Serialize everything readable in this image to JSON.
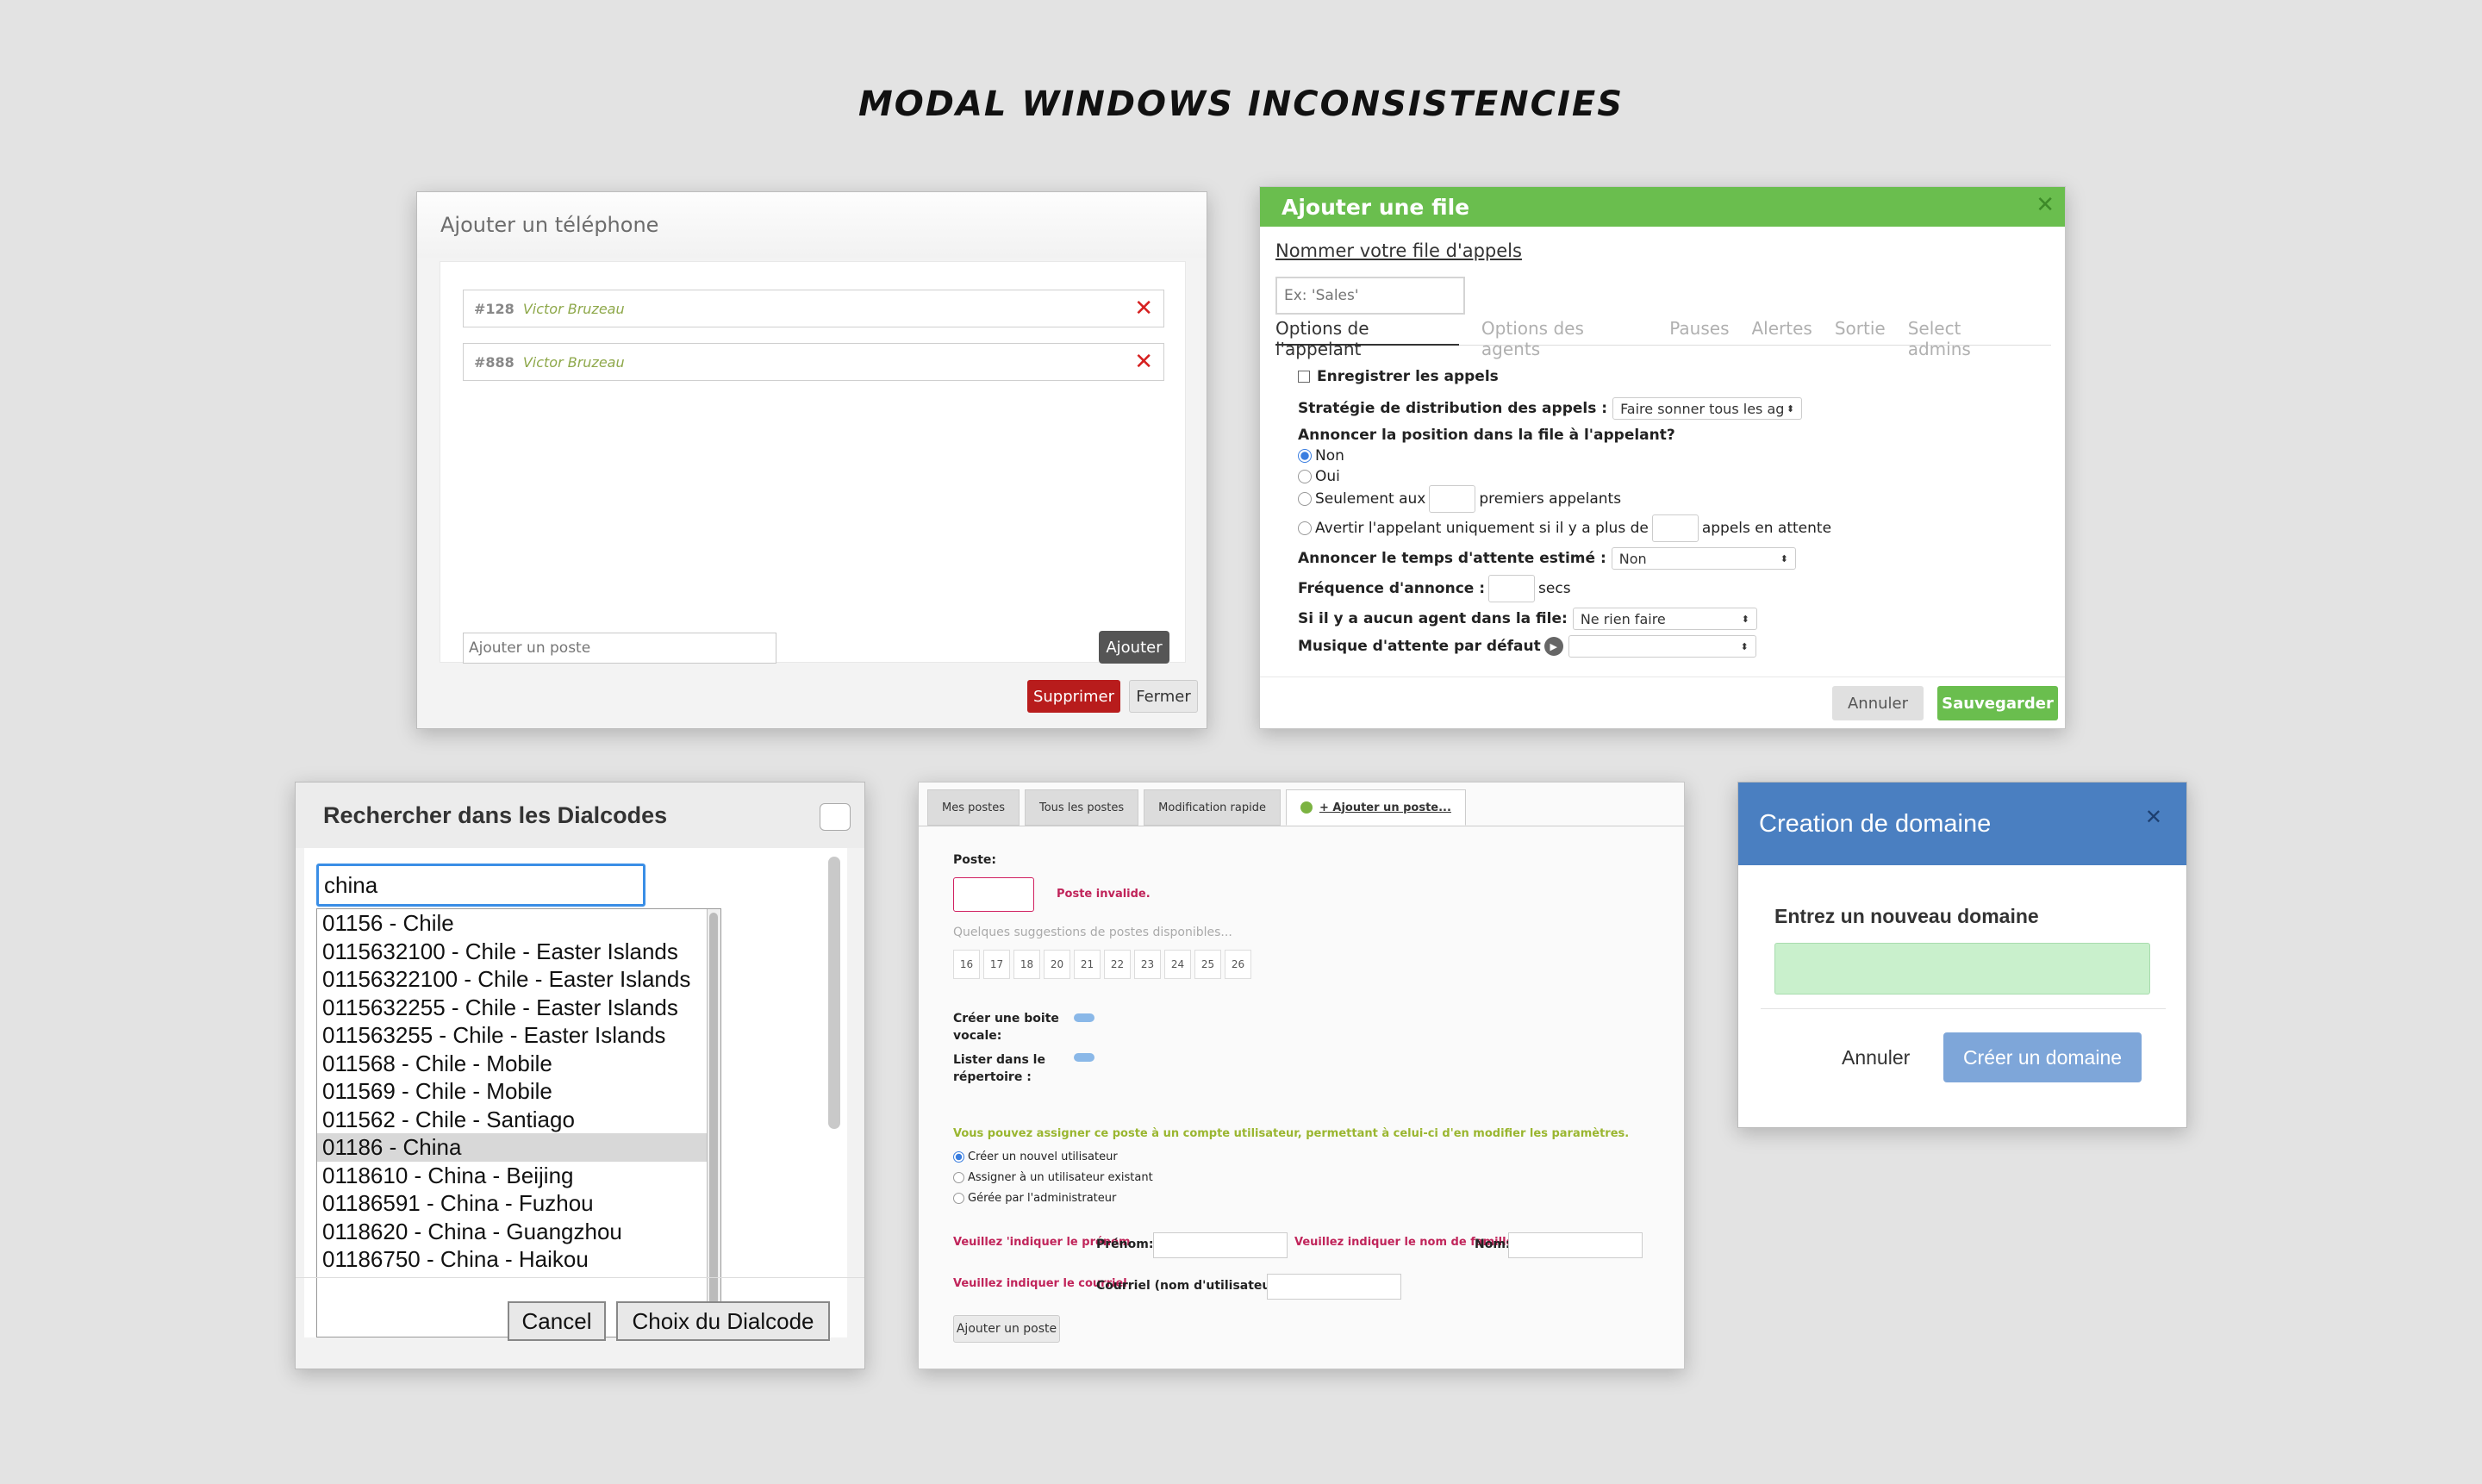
{
  "title": "MODAL WINDOWS INCONSISTENCIES",
  "modal_phone": {
    "title": "Ajouter un téléphone",
    "rows": [
      {
        "number": "#128",
        "name": "Victor Bruzeau"
      },
      {
        "number": "#888",
        "name": "Victor Bruzeau"
      }
    ],
    "poste_placeholder": "Ajouter un poste",
    "add_label": "Ajouter",
    "delete_label": "Supprimer",
    "close_label": "Fermer"
  },
  "modal_queue": {
    "title": "Ajouter une file",
    "subtitle": "Nommer votre file d'appels",
    "name_placeholder": "Ex: 'Sales'",
    "tabs": [
      "Options de l'appelant",
      "Options des agents",
      "Pauses",
      "Alertes",
      "Sortie",
      "Select admins"
    ],
    "record_label": "Enregistrer les appels",
    "strategy_label": "Stratégie de distribution des appels :",
    "strategy_value": "Faire sonner tous les agents",
    "announce_position_label": "Annoncer la position dans la file à l'appelant?",
    "opt_non": "Non",
    "opt_oui": "Oui",
    "opt_only_pre": "Seulement aux",
    "opt_only_post": "premiers appelants",
    "opt_warn_pre": "Avertir l'appelant uniquement si il y a plus de",
    "opt_warn_post": "appels en attente",
    "wait_label": "Annoncer le temps d'attente estimé :",
    "wait_value": "Non",
    "freq_label": "Fréquence d'annonce :",
    "freq_unit": "secs",
    "no_agent_label": "Si il y a aucun agent dans la file:",
    "no_agent_value": "Ne rien faire",
    "music_label": "Musique d'attente par défaut",
    "cancel_label": "Annuler",
    "save_label": "Sauvegarder"
  },
  "modal_dialcodes": {
    "title": "Rechercher dans les Dialcodes",
    "search_value": "china",
    "items": [
      "01156 - Chile",
      "0115632100 - Chile - Easter Islands",
      "01156322100 - Chile - Easter Islands",
      "0115632255 - Chile - Easter Islands",
      "011563255 - Chile - Easter Islands",
      "011568 - Chile - Mobile",
      "011569 - Chile - Mobile",
      "011562 - Chile - Santiago",
      "01186 - China",
      "0118610 - China - Beijing",
      "01186591 - China - Fuzhou",
      "0118620 - China - Guangzhou",
      "01186750 - China - Haikou"
    ],
    "selected_index": 8,
    "cancel_label": "Cancel",
    "choose_label": "Choix du Dialcode"
  },
  "modal_postes": {
    "tabs": [
      "Mes postes",
      "Tous les postes",
      "Modification rapide",
      "+ Ajouter un poste..."
    ],
    "poste_label": "Poste:",
    "poste_error": "Poste invalide.",
    "suggest_text": "Quelques suggestions de postes disponibles...",
    "suggestions": [
      "16",
      "17",
      "18",
      "20",
      "21",
      "22",
      "23",
      "24",
      "25",
      "26"
    ],
    "voicemail_label": "Créer une boite vocale:",
    "directory_label": "Lister dans le répertoire :",
    "assign_text": "Vous pouvez assigner ce poste à un compte utilisateur, permettant à celui-ci d'en modifier les paramètres.",
    "assign_options": [
      "Créer un nouvel utilisateur",
      "Assigner à un utilisateur existant",
      "Gérée par l'administrateur"
    ],
    "firstname_error": "Veuillez 'indiquer le prénom",
    "firstname_label": "Prénom:",
    "lastname_error": "Veuillez indiquer le nom de famille",
    "lastname_label": "Nom:",
    "email_error": "Veuillez indiquer le courriel",
    "email_label": "Courriel (nom d'utilisateur):",
    "add_label": "Ajouter un poste"
  },
  "modal_domain": {
    "title": "Creation de domaine",
    "label": "Entrez un nouveau domaine",
    "cancel_label": "Annuler",
    "create_label": "Créer un domaine"
  },
  "colors": {
    "green": "#6abe4e",
    "blue": "#4a7fc1",
    "red": "#b81c1c"
  }
}
